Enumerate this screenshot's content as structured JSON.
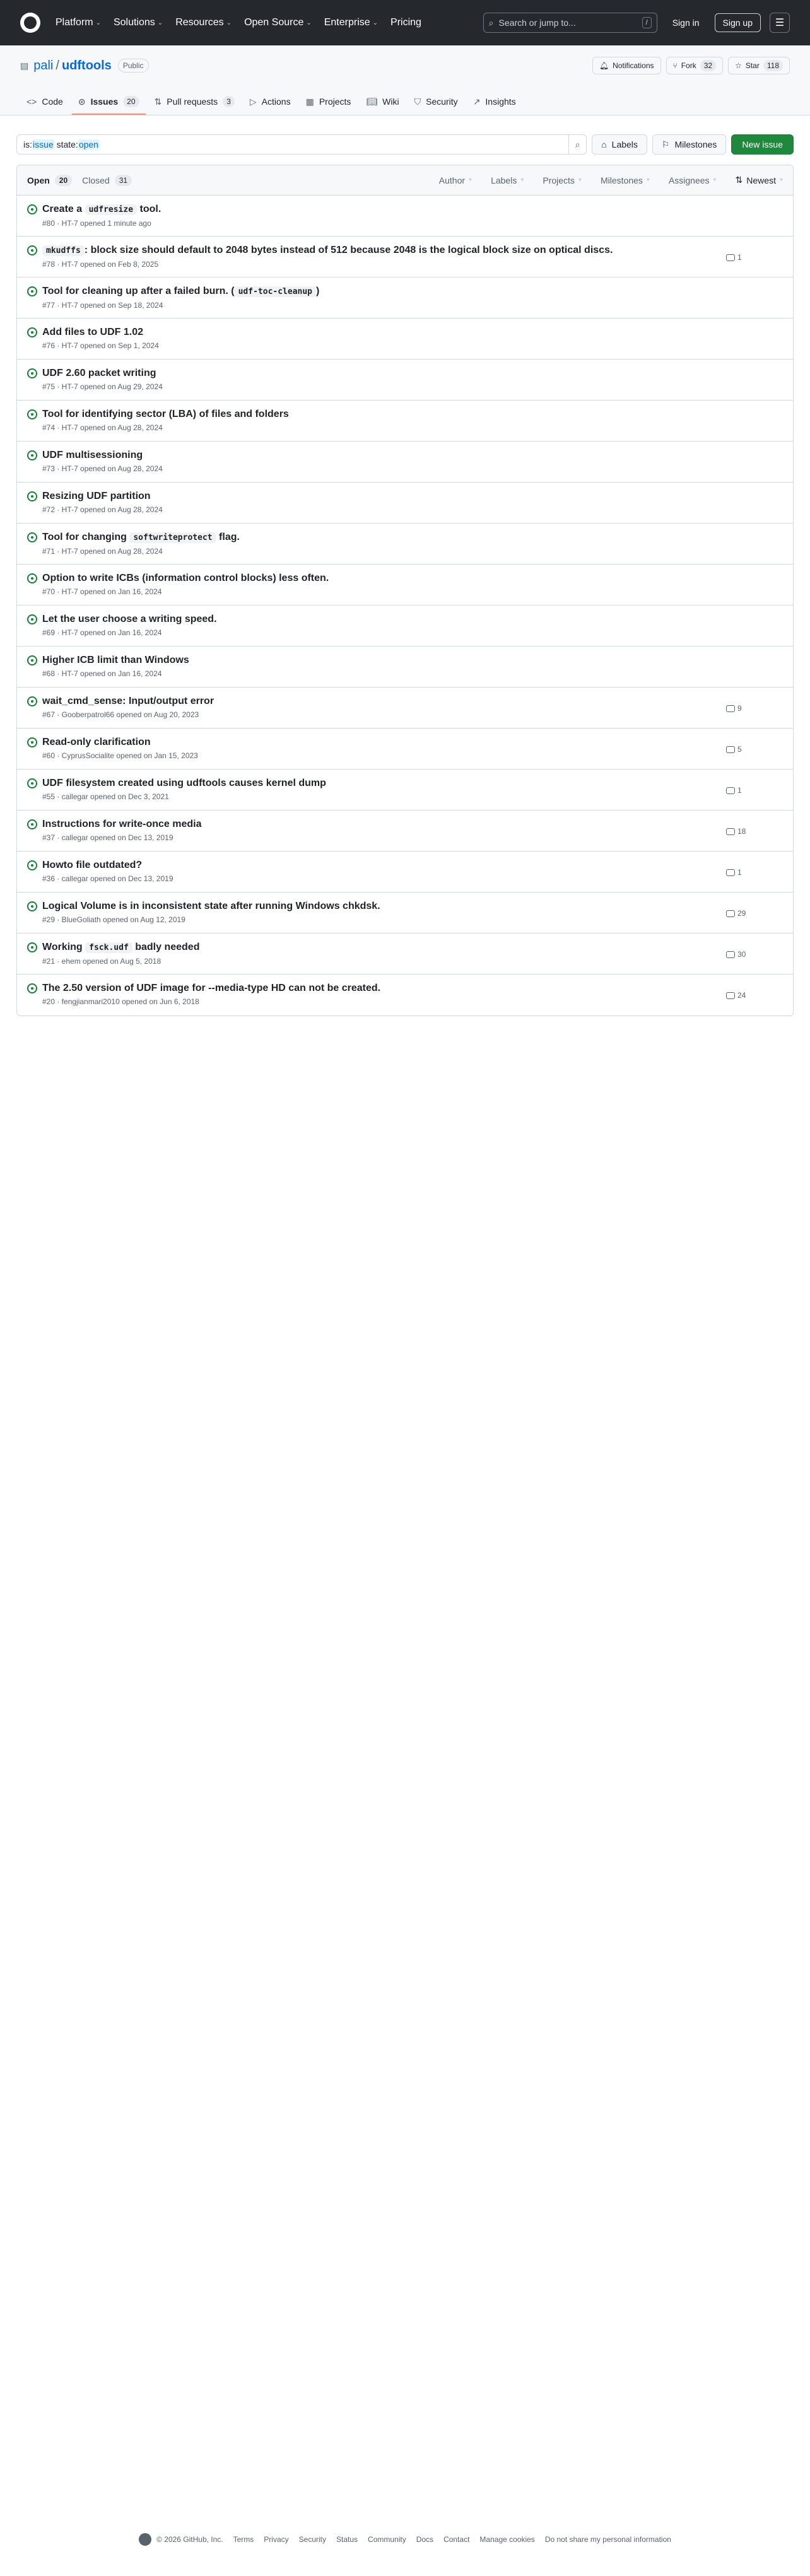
{
  "nav": {
    "links": [
      "Platform",
      "Solutions",
      "Resources",
      "Open Source",
      "Enterprise",
      "Pricing"
    ],
    "search_placeholder": "Search or jump to...",
    "slash_key": "/",
    "signin": "Sign in",
    "signup": "Sign up"
  },
  "repo": {
    "owner": "pali",
    "sep": "/",
    "name": "udftools",
    "visibility": "Public",
    "notifications": "Notifications",
    "fork_label": "Fork",
    "fork_count": "32",
    "star_label": "Star",
    "star_count": "118",
    "tabs": [
      {
        "label": "Code",
        "count": null
      },
      {
        "label": "Issues",
        "count": "20"
      },
      {
        "label": "Pull requests",
        "count": "3"
      },
      {
        "label": "Actions",
        "count": null
      },
      {
        "label": "Projects",
        "count": null
      },
      {
        "label": "Wiki",
        "count": null
      },
      {
        "label": "Security",
        "count": null
      },
      {
        "label": "Insights",
        "count": null
      }
    ]
  },
  "filter": {
    "is_key": "is:",
    "is_val": "issue",
    "state_key": "state:",
    "state_val": "open",
    "labels": "Labels",
    "milestones": "Milestones",
    "new_issue": "New issue"
  },
  "list": {
    "open_label": "Open",
    "open_count": "20",
    "closed_label": "Closed",
    "closed_count": "31",
    "filters": [
      "Author",
      "Labels",
      "Projects",
      "Milestones",
      "Assignees"
    ],
    "sort": "Newest",
    "issues": [
      {
        "pre": "Create a ",
        "code": "udfresize",
        "post": " tool.",
        "meta": "#80 · HT-7 opened 1 minute ago",
        "comments": ""
      },
      {
        "pre": "",
        "code": "mkudffs",
        "post": ": block size should default to 2048 bytes instead of 512 because 2048 is the logical block size on optical discs.",
        "meta": "#78 · HT-7 opened on Feb 8, 2025",
        "comments": "1"
      },
      {
        "pre": "Tool for cleaning up after a failed burn. (",
        "code": "udf-toc-cleanup",
        "post": ")",
        "meta": "#77 · HT-7 opened on Sep 18, 2024",
        "comments": ""
      },
      {
        "pre": "Add files to UDF 1.02",
        "code": "",
        "post": "",
        "meta": "#76 · HT-7 opened on Sep 1, 2024",
        "comments": ""
      },
      {
        "pre": "UDF 2.60 packet writing",
        "code": "",
        "post": "",
        "meta": "#75 · HT-7 opened on Aug 29, 2024",
        "comments": ""
      },
      {
        "pre": "Tool for identifying sector (LBA) of files and folders",
        "code": "",
        "post": "",
        "meta": "#74 · HT-7 opened on Aug 28, 2024",
        "comments": ""
      },
      {
        "pre": "UDF multisessioning",
        "code": "",
        "post": "",
        "meta": "#73 · HT-7 opened on Aug 28, 2024",
        "comments": ""
      },
      {
        "pre": "Resizing UDF partition",
        "code": "",
        "post": "",
        "meta": "#72 · HT-7 opened on Aug 28, 2024",
        "comments": ""
      },
      {
        "pre": "Tool for changing ",
        "code": "softwriteprotect",
        "post": " flag.",
        "meta": "#71 · HT-7 opened on Aug 28, 2024",
        "comments": ""
      },
      {
        "pre": "Option to write ICBs (information control blocks) less often.",
        "code": "",
        "post": "",
        "meta": "#70 · HT-7 opened on Jan 16, 2024",
        "comments": ""
      },
      {
        "pre": "Let the user choose a writing speed.",
        "code": "",
        "post": "",
        "meta": "#69 · HT-7 opened on Jan 16, 2024",
        "comments": ""
      },
      {
        "pre": "Higher ICB limit than Windows",
        "code": "",
        "post": "",
        "meta": "#68 · HT-7 opened on Jan 16, 2024",
        "comments": ""
      },
      {
        "pre": "wait_cmd_sense: Input/output error",
        "code": "",
        "post": "",
        "meta": "#67 · Gooberpatrol66 opened on Aug 20, 2023",
        "comments": "9"
      },
      {
        "pre": "Read-only clarification",
        "code": "",
        "post": "",
        "meta": "#60 · CyprusSocialite opened on Jan 15, 2023",
        "comments": "5"
      },
      {
        "pre": "UDF filesystem created using udftools causes kernel dump",
        "code": "",
        "post": "",
        "meta": "#55 · callegar opened on Dec 3, 2021",
        "comments": "1"
      },
      {
        "pre": "Instructions for write-once media",
        "code": "",
        "post": "",
        "meta": "#37 · callegar opened on Dec 13, 2019",
        "comments": "18"
      },
      {
        "pre": "Howto file outdated?",
        "code": "",
        "post": "",
        "meta": "#36 · callegar opened on Dec 13, 2019",
        "comments": "1"
      },
      {
        "pre": "Logical Volume is in inconsistent state after running Windows chkdsk.",
        "code": "",
        "post": "",
        "meta": "#29 · BlueGoliath opened on Aug 12, 2019",
        "comments": "29"
      },
      {
        "pre": "Working ",
        "code": "fsck.udf",
        "post": " badly needed",
        "meta": "#21 · ehem opened on Aug 5, 2018",
        "comments": "30"
      },
      {
        "pre": "The 2.50 version of UDF image for --media-type HD can not be created.",
        "code": "",
        "post": "",
        "meta": "#20 · fengjianmari2010 opened on Jun 6, 2018",
        "comments": "24"
      }
    ]
  },
  "footer": {
    "copyright": "© 2026 GitHub, Inc.",
    "links": [
      "Terms",
      "Privacy",
      "Security",
      "Status",
      "Community",
      "Docs",
      "Contact",
      "Manage cookies",
      "Do not share my personal information"
    ]
  }
}
